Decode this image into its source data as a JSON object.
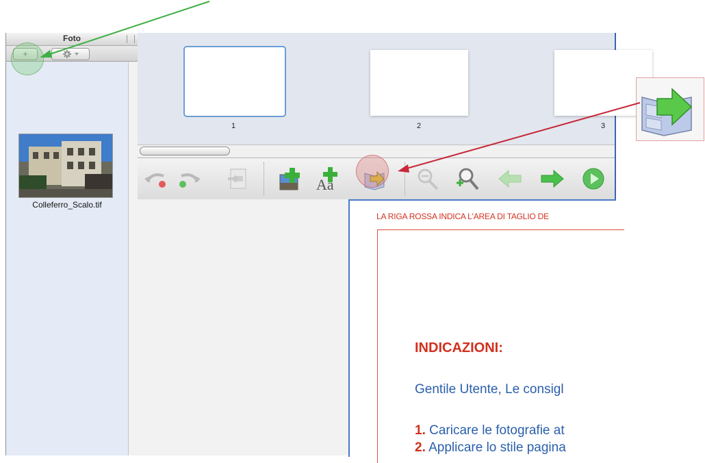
{
  "panel": {
    "title": "Foto",
    "add_label": "+",
    "photos": [
      {
        "name": "Colleferro_Scalo.tif"
      }
    ]
  },
  "pages": {
    "thumbs": [
      {
        "number": "1"
      },
      {
        "number": "2"
      },
      {
        "number": "3"
      }
    ]
  },
  "toolbar": {
    "tools": [
      "undo-icon",
      "redo-icon",
      "save-page-icon",
      "add-photo-icon",
      "add-text-icon",
      "apply-layout-icon",
      "zoom-out-icon",
      "zoom-in-icon",
      "prev-page-icon",
      "next-page-icon",
      "play-icon"
    ]
  },
  "document": {
    "crop_note": "LA RIGA ROSSA INDICA L'AREA DI TAGLIO DE",
    "heading": "INDICAZIONI:",
    "intro": "Gentile Utente, Le consigl",
    "steps": [
      {
        "num": "1.",
        "text": " Caricare le fotografie at"
      },
      {
        "num": "2.",
        "text": " Applicare lo stile pagina"
      }
    ]
  },
  "colors": {
    "accent_blue": "#3a62b6",
    "crop_red": "#d2301e",
    "arrow_green": "#3cb043",
    "arrow_red": "#c8283a"
  }
}
